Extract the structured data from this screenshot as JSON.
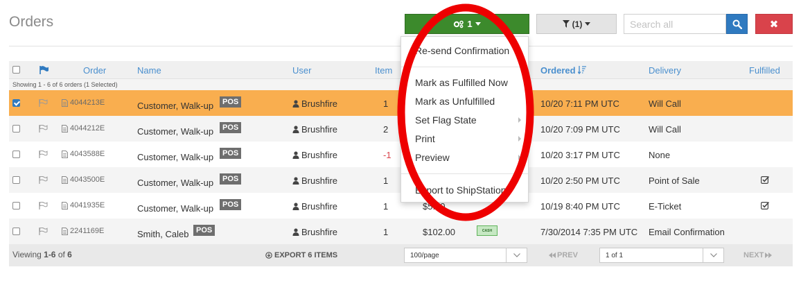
{
  "page": {
    "title": "Orders"
  },
  "toolbar": {
    "actions_label": "1",
    "filter_label": "(1)",
    "search_placeholder": "Search all"
  },
  "columns": {
    "order": "Order",
    "name": "Name",
    "user": "User",
    "items": "Item",
    "ordered": "Ordered",
    "delivery": "Delivery",
    "fulfilled": "Fulfilled"
  },
  "showing_text": "Showing 1 - 6 of 6 orders (1 Selected)",
  "rows": [
    {
      "order": "4044213E",
      "name": "Customer, Walk-up",
      "badge": "POS",
      "user": "Brushfire",
      "items": "1",
      "total": "",
      "payment": "",
      "ordered": "10/20 7:11 PM UTC",
      "delivery": "Will Call",
      "fulfilled": false,
      "selected": true
    },
    {
      "order": "4044212E",
      "name": "Customer, Walk-up",
      "badge": "POS",
      "user": "Brushfire",
      "items": "2",
      "total": "",
      "payment": "",
      "ordered": "10/20 7:09 PM UTC",
      "delivery": "Will Call",
      "fulfilled": false,
      "selected": false
    },
    {
      "order": "4043588E",
      "name": "Customer, Walk-up",
      "badge": "POS",
      "user": "Brushfire",
      "items": "-1",
      "total": "",
      "payment": "",
      "ordered": "10/20 3:17 PM UTC",
      "delivery": "None",
      "fulfilled": false,
      "selected": false
    },
    {
      "order": "4043500E",
      "name": "Customer, Walk-up",
      "badge": "POS",
      "user": "Brushfire",
      "items": "1",
      "total": "",
      "payment": "",
      "ordered": "10/20 2:50 PM UTC",
      "delivery": "Point of Sale",
      "fulfilled": true,
      "selected": false
    },
    {
      "order": "4041935E",
      "name": "Customer, Walk-up",
      "badge": "POS",
      "user": "Brushfire",
      "items": "1",
      "total": "$5.00",
      "payment": "",
      "ordered": "10/19 8:40 PM UTC",
      "delivery": "E-Ticket",
      "fulfilled": true,
      "selected": false
    },
    {
      "order": "2241169E",
      "name": "Smith, Caleb",
      "badge": "POS",
      "user": "Brushfire",
      "items": "1",
      "total": "$102.00",
      "payment": "CASH",
      "ordered": "7/30/2014 7:35 PM UTC",
      "delivery": "Email Confirmation",
      "fulfilled": false,
      "selected": false
    }
  ],
  "footer": {
    "viewing_prefix": "Viewing ",
    "viewing_range": "1-6",
    "viewing_mid": " of ",
    "viewing_total": "6",
    "export_label": "EXPORT 6 ITEMS",
    "per_page": "100/page",
    "prev_label": "PREV",
    "page_select": "1 of 1",
    "next_label": "NEXT"
  },
  "dropdown": {
    "resend": "Re-send Confirmation",
    "mark_fulfilled": "Mark as Fulfilled Now",
    "mark_unfulfilled": "Mark as Unfulfilled",
    "set_flag": "Set Flag State",
    "print": "Print",
    "preview": "Preview",
    "export_shipstation": "Export to ShipStation"
  },
  "colors": {
    "accent_green": "#3c8a2c",
    "header_blue": "#4a8fce",
    "selected_row": "#f9ae4f",
    "danger_red": "#d9434b",
    "annotation_red": "#ee0000"
  }
}
